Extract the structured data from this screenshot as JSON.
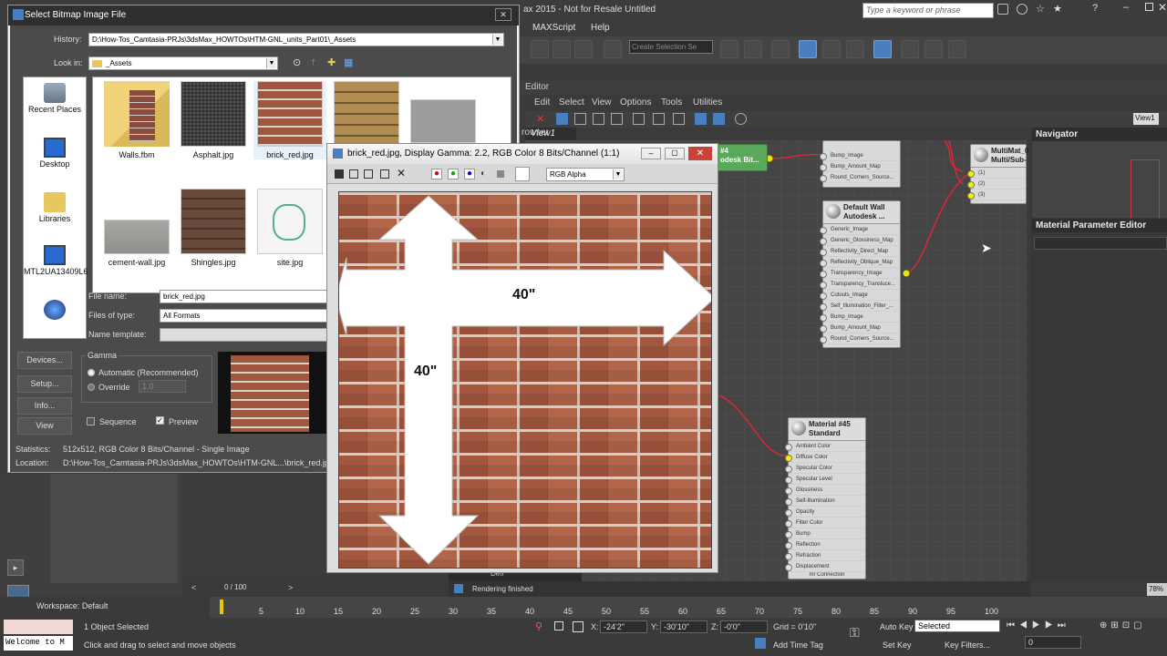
{
  "max": {
    "title": "ax 2015  -  Not for Resale   Untitled",
    "search_placeholder": "Type a keyword or phrase",
    "menu": [
      "MAXScript",
      "Help"
    ],
    "selection_set_placeholder": "Create Selection Se"
  },
  "slate": {
    "header_left": "rowser",
    "editor_label": "Editor",
    "menu": [
      "Edit",
      "Select",
      "View",
      "Options",
      "Tools",
      "Utilities"
    ],
    "view_tab": "View1",
    "view_dropdown": "View1",
    "navigator_title": "Navigator",
    "param_editor_title": "Material Parameter Editor",
    "nodes": {
      "bitmap_partial": {
        "title_line1": "#4",
        "title_line2": "odesk Bit..."
      },
      "top_slots": [
        "Bump_Image",
        "Bump_Amount_Map",
        "Round_Corners_Source..."
      ],
      "default_wall": {
        "title_line1": "Default Wall",
        "title_line2": "Autodesk ...",
        "slots": [
          "Generic_Image",
          "Generic_Glossiness_Map",
          "Reflectivity_Direct_Map",
          "Reflectivity_Oblique_Map",
          "Transparency_Image",
          "Transparency_Transluce...",
          "Cutouts_Image",
          "Self_Illumination_Filter_...",
          "Bump_Image",
          "Bump_Amount_Map",
          "Round_Corners_Source..."
        ]
      },
      "multimat": {
        "title_line1": "MultiMat_0",
        "title_line2": "Multi/Sub-",
        "slots": [
          "(1)",
          "(2)",
          "(3)"
        ]
      },
      "material45": {
        "title_line1": "Material #45",
        "title_line2": "Standard",
        "slots": [
          "Ambient Color",
          "Diffuse Color",
          "Specular Color",
          "Specular Level",
          "Glossiness",
          "Self-Illumination",
          "Opacity",
          "Filter Color",
          "Bump",
          "Reflection",
          "Refraction",
          "Displacement"
        ],
        "footer": "mr Connection"
      }
    },
    "render_status": "Rendering finished",
    "render_tab": "Defl",
    "zoom": "78%"
  },
  "dialog": {
    "title": "Select Bitmap Image File",
    "history_label": "History:",
    "history_value": "D:\\How-Tos_Camtasia-PRJs\\3dsMax_HOWTOs\\HTM-GNL_units_Part01\\_Assets",
    "lookin_label": "Look in:",
    "lookin_value": "_Assets",
    "places": [
      "Recent Places",
      "Desktop",
      "Libraries",
      "MTL2UA13409L6",
      ""
    ],
    "files": [
      {
        "name": "Walls.fbm",
        "kind": "folder"
      },
      {
        "name": "Asphalt.jpg",
        "kind": "asphalt"
      },
      {
        "name": "brick_red.jpg",
        "kind": "brick"
      },
      {
        "name": "",
        "kind": "tan"
      },
      {
        "name": "",
        "kind": "grey"
      },
      {
        "name": "cement-wall.jpg",
        "kind": "cement"
      },
      {
        "name": "Shingles.jpg",
        "kind": "shingles"
      },
      {
        "name": "site.jpg",
        "kind": "site"
      }
    ],
    "filename_label": "File name:",
    "filename_value": "brick_red.jpg",
    "filetype_label": "Files of type:",
    "filetype_value": "All Formats",
    "nametemplate_label": "Name template:",
    "side_buttons": [
      "Devices...",
      "Setup...",
      "Info...",
      "View"
    ],
    "gamma_label": "Gamma",
    "gamma_auto": "Automatic (Recommended)",
    "gamma_override": "Override",
    "gamma_override_value": "1.0",
    "sequence_label": "Sequence",
    "preview_label": "Preview",
    "statistics_label": "Statistics:",
    "statistics_value": "512x512, RGB Color 8 Bits/Channel - Single Image",
    "location_label": "Location:",
    "location_value": "D:\\How-Tos_Camtasia-PRJs\\3dsMax_HOWTOs\\HTM-GNL...\\brick_red.jpg"
  },
  "viewer": {
    "title": "brick_red.jpg, Display Gamma: 2.2, RGB Color 8 Bits/Channel (1:1)",
    "channel": "RGB Alpha",
    "label_h": "40\"",
    "label_v": "40\""
  },
  "bottom": {
    "workspace": "Workspace: Default",
    "frame": "0 / 100",
    "ticks": [
      "5",
      "10",
      "15",
      "20",
      "25",
      "30",
      "35",
      "40",
      "45",
      "50",
      "55",
      "60",
      "65",
      "70",
      "75",
      "80",
      "85",
      "90",
      "95",
      "100"
    ],
    "listener": "Welcome to M",
    "selected": "1 Object Selected",
    "hint": "Click and drag to select and move objects",
    "x_label": "X:",
    "x": "-24'2\"",
    "y_label": "Y:",
    "y": "-30'10\"",
    "z_label": "Z:",
    "z": "-0'0\"",
    "grid": "Grid = 0'10\"",
    "add_time_tag": "Add Time Tag",
    "auto_key": "Auto Key",
    "set_key": "Set Key",
    "selected_dropdown": "Selected",
    "key_filters": "Key Filters...",
    "frame_field": "0"
  }
}
